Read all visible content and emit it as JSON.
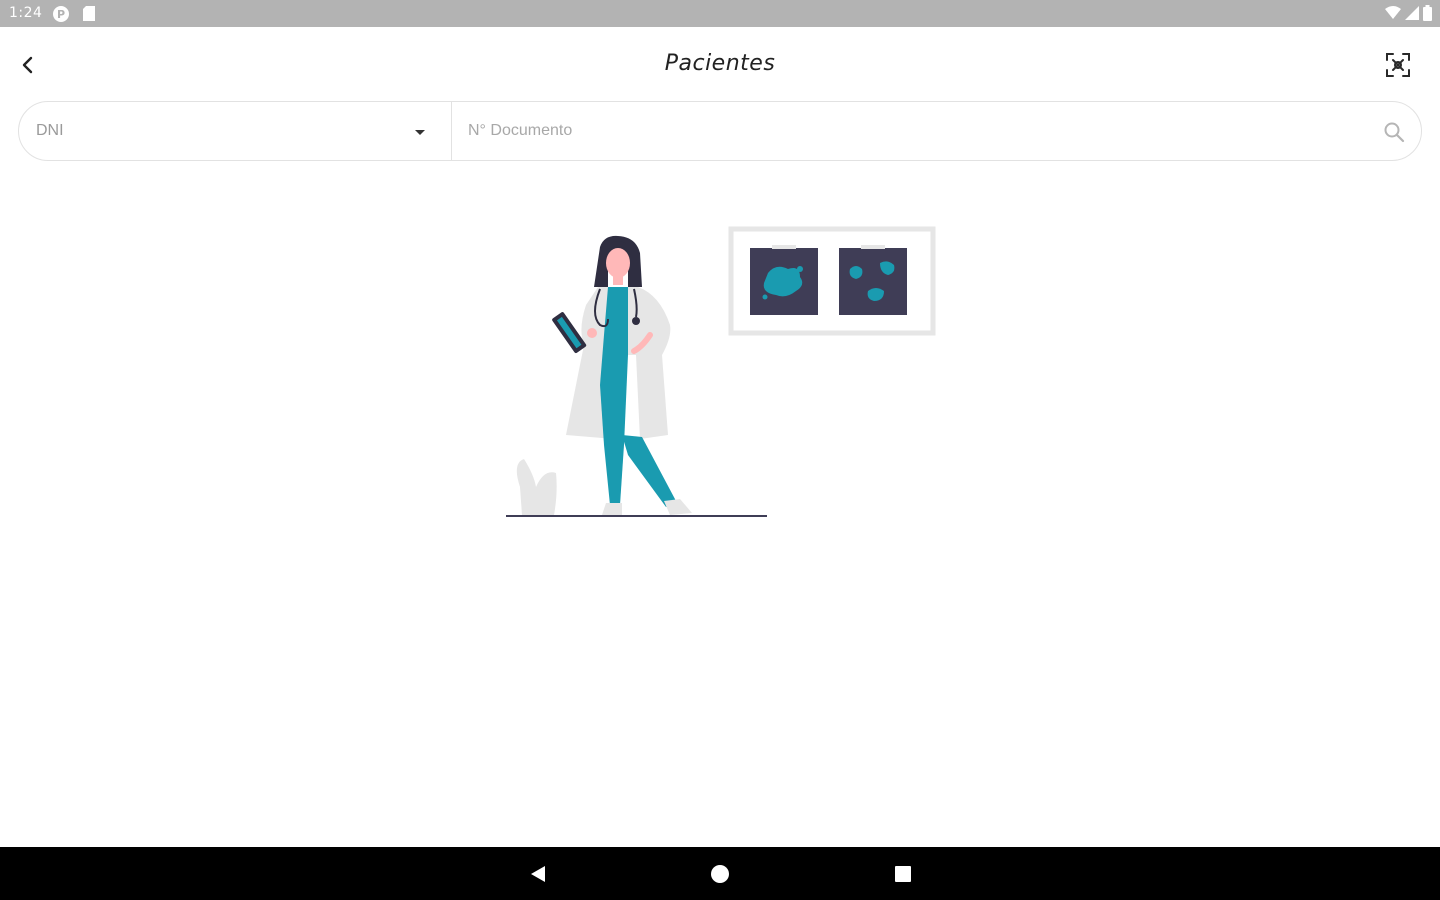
{
  "status_bar": {
    "time": "1:24",
    "icons": [
      "p-badge-icon",
      "sd-card-icon",
      "wifi-icon",
      "signal-icon",
      "battery-icon"
    ]
  },
  "app_bar": {
    "title": "Pacientes",
    "back_icon": "chevron-left-icon",
    "scan_icon": "scan-icon"
  },
  "search": {
    "doc_type_selected": "DNI",
    "doc_number_placeholder": "N° Documento",
    "doc_number_value": "",
    "search_icon": "search-icon"
  },
  "illustration": {
    "subject": "doctor-with-xray-illustration",
    "colors": {
      "accent": "#1a9bb0",
      "dark": "#2f2e41",
      "coat": "#e6e6e6",
      "skin": "#ffb8b8",
      "xray_bg": "#3f3d56"
    }
  },
  "nav_bar": {
    "back": "triangle-back-icon",
    "home": "circle-home-icon",
    "recents": "square-recents-icon"
  }
}
